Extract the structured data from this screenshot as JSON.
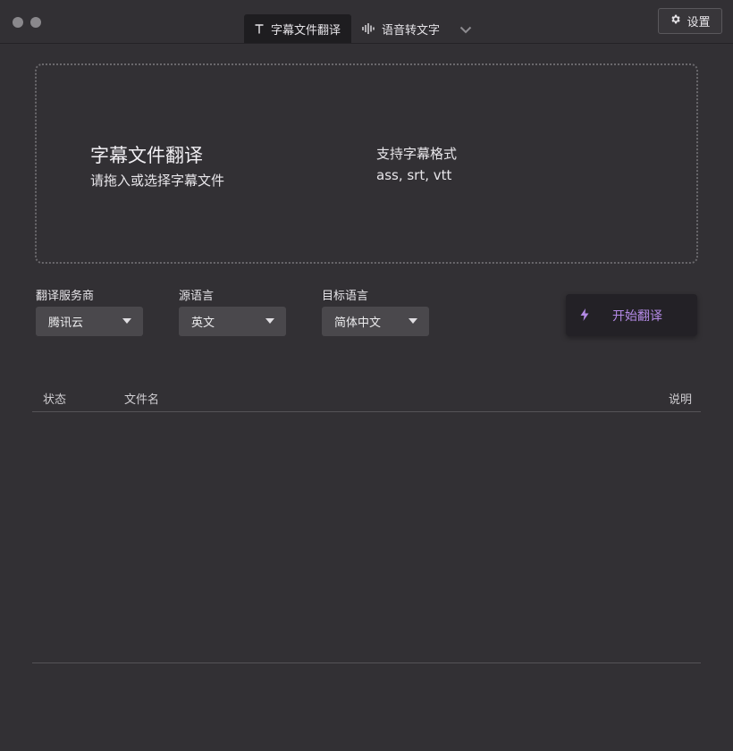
{
  "header": {
    "tabs": [
      {
        "label": "字幕文件翻译",
        "icon": "text-icon",
        "active": true
      },
      {
        "label": "语音转文字",
        "icon": "waveform-icon",
        "active": false
      }
    ],
    "more_icon": "chevron-down-icon",
    "settings_label": "设置",
    "settings_icon": "gear-icon"
  },
  "dropzone": {
    "title": "字幕文件翻译",
    "subtitle": "请拖入或选择字幕文件",
    "formats_label": "支持字幕格式",
    "formats_value": "ass, srt, vtt"
  },
  "options": {
    "provider": {
      "label": "翻译服务商",
      "value": "腾讯云"
    },
    "source_lang": {
      "label": "源语言",
      "value": "英文"
    },
    "target_lang": {
      "label": "目标语言",
      "value": "简体中文"
    }
  },
  "start_button": {
    "label": "开始翻译",
    "icon": "lightning-icon",
    "color": "#b48ae6"
  },
  "table": {
    "columns": [
      "状态",
      "文件名",
      "说明"
    ],
    "rows": []
  }
}
